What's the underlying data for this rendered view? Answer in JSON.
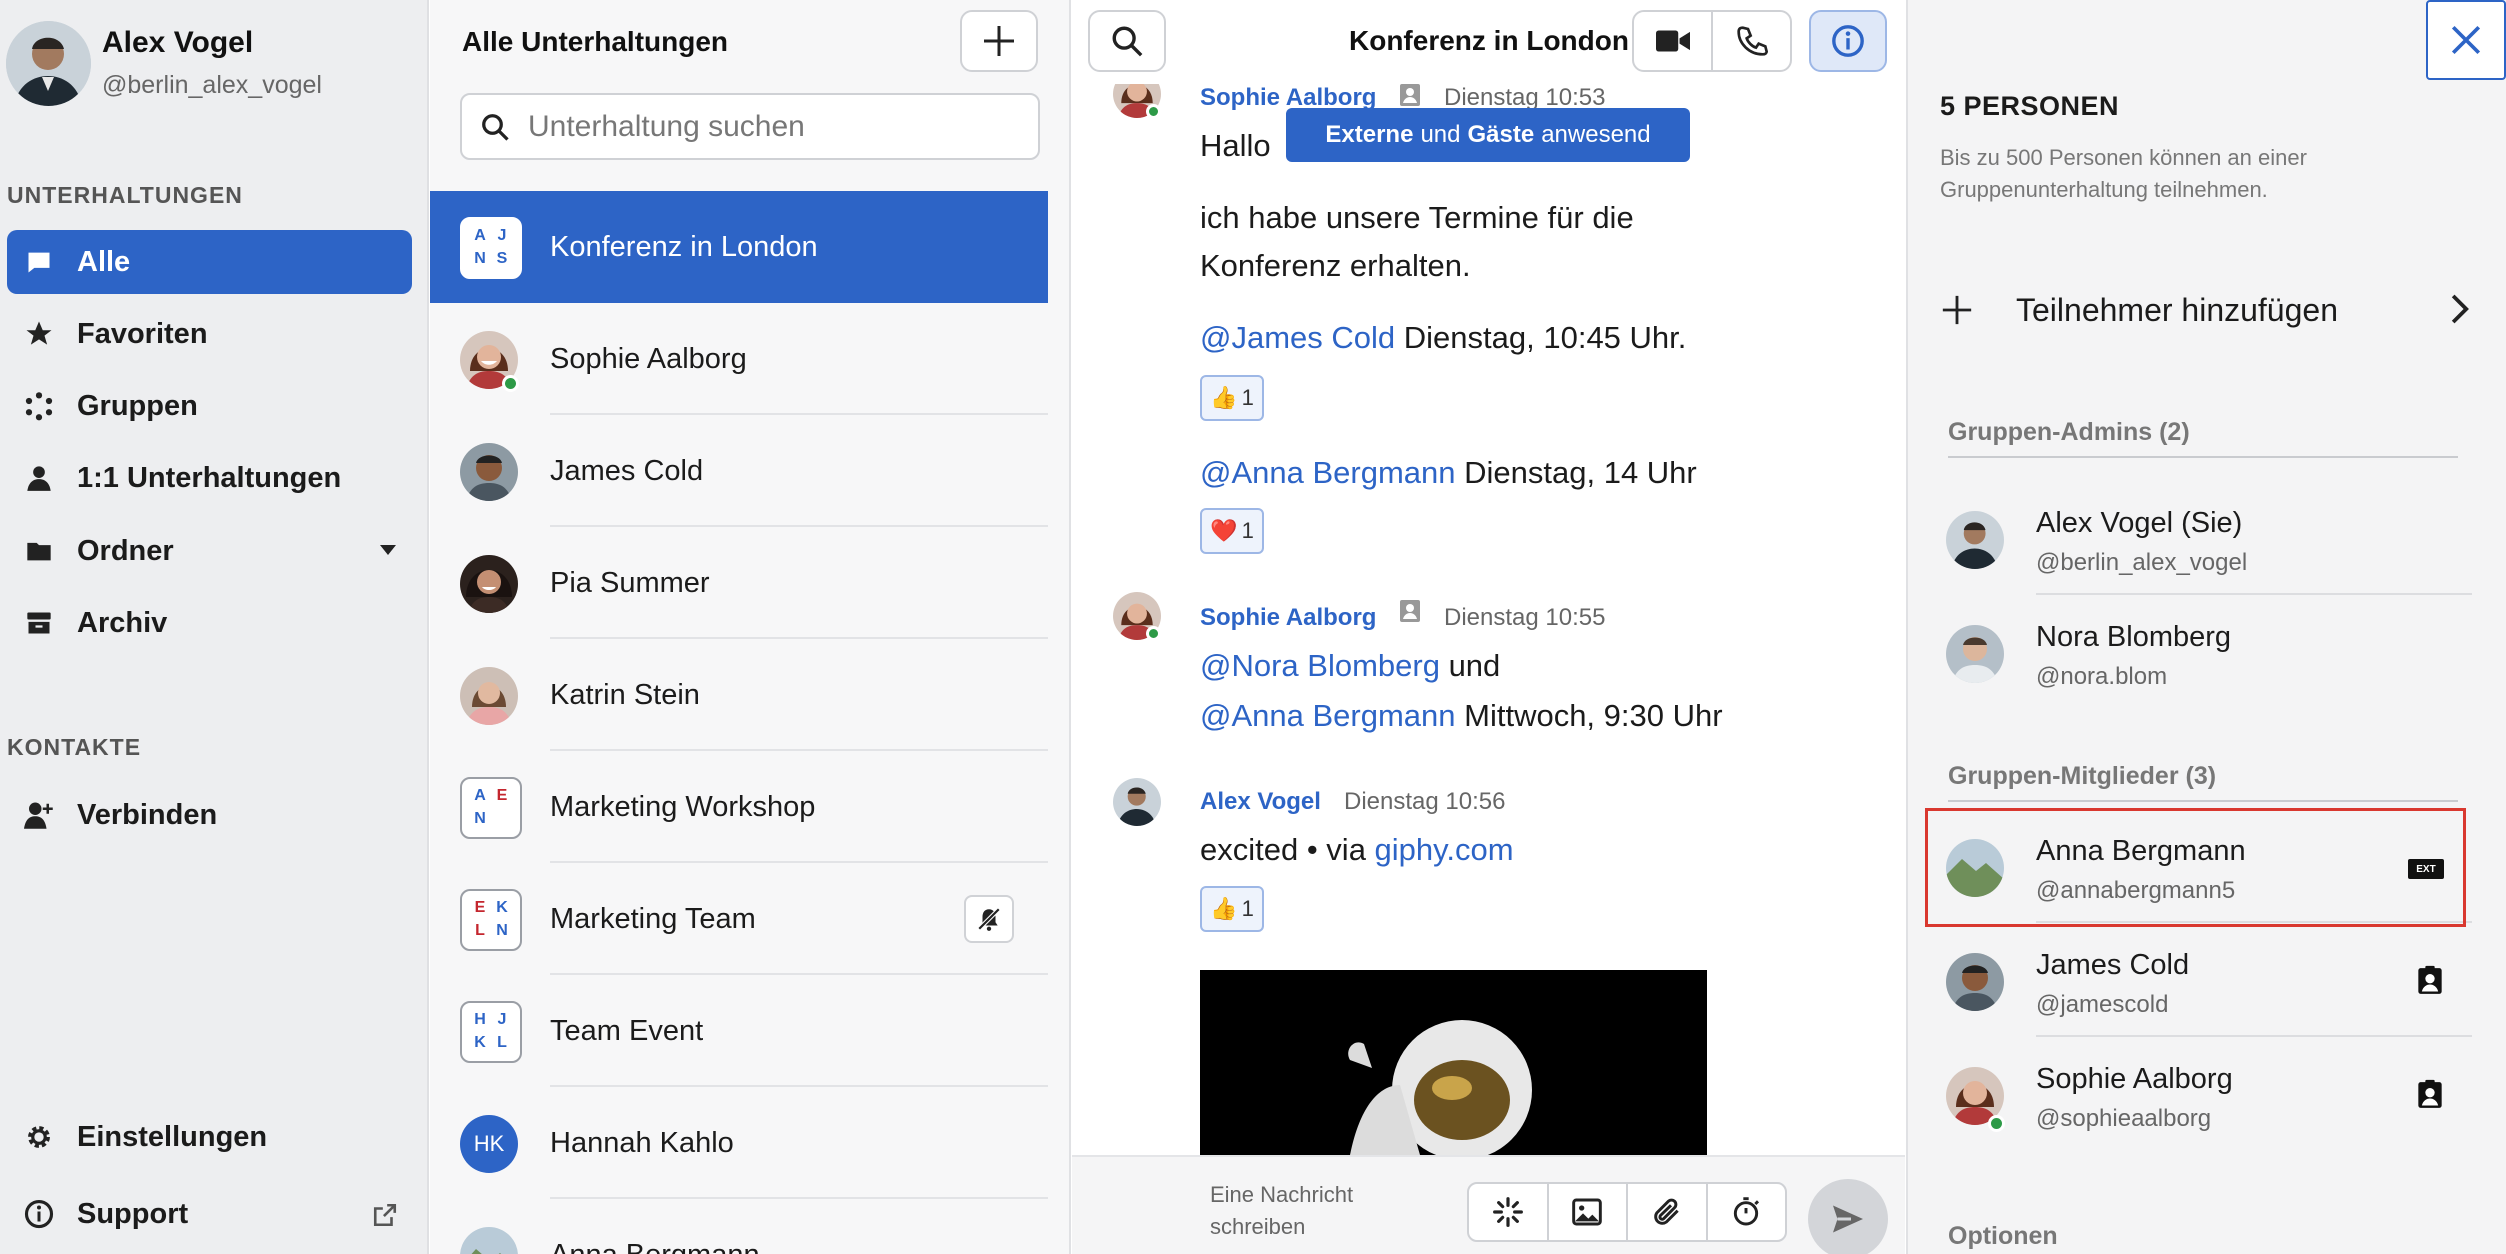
{
  "profile": {
    "name": "Alex Vogel",
    "handle": "@berlin_alex_vogel"
  },
  "sidebar": {
    "section_conversations": "UNTERHALTUNGEN",
    "items": [
      {
        "label": "Alle",
        "icon": "chat-bubble-icon",
        "active": true
      },
      {
        "label": "Favoriten",
        "icon": "star-icon"
      },
      {
        "label": "Gruppen",
        "icon": "group-dots-icon"
      },
      {
        "label": "1:1 Unterhaltungen",
        "icon": "person-icon"
      },
      {
        "label": "Ordner",
        "icon": "folder-icon"
      },
      {
        "label": "Archiv",
        "icon": "archive-icon"
      }
    ],
    "section_contacts": "KONTAKTE",
    "connect_label": "Verbinden",
    "settings_label": "Einstellungen",
    "support_label": "Support"
  },
  "conversations": {
    "title": "Alle Unterhaltungen",
    "search_placeholder": "Unterhaltung suchen",
    "items": [
      {
        "name": "Konferenz in London",
        "group": [
          [
            "A",
            "b"
          ],
          [
            "J",
            "b"
          ],
          [
            "N",
            "b"
          ],
          [
            "S",
            "b"
          ]
        ],
        "active": true
      },
      {
        "name": "Sophie Aalborg",
        "online": true
      },
      {
        "name": "James Cold"
      },
      {
        "name": "Pia Summer"
      },
      {
        "name": "Katrin Stein"
      },
      {
        "name": "Marketing Workshop",
        "group": [
          [
            "A",
            "b"
          ],
          [
            "E",
            "r"
          ],
          [
            "N",
            "b"
          ],
          [
            "",
            ""
          ]
        ]
      },
      {
        "name": "Marketing Team",
        "group": [
          [
            "E",
            "r"
          ],
          [
            "K",
            "b"
          ],
          [
            "L",
            "r"
          ],
          [
            "N",
            "b"
          ]
        ],
        "muted": true
      },
      {
        "name": "Team Event",
        "group": [
          [
            "H",
            "b"
          ],
          [
            "J",
            "b"
          ],
          [
            "K",
            "b"
          ],
          [
            "L",
            "b"
          ]
        ]
      },
      {
        "name": "Hannah Kahlo",
        "initials": "HK"
      },
      {
        "name": "Anna Bergmann"
      }
    ]
  },
  "chat": {
    "title": "Konferenz in London",
    "banner_strong1": "Externe",
    "banner_mid": "und",
    "banner_strong2": "Gäste",
    "banner_end": "anwesend",
    "msg1": {
      "sender": "Sophie Aalborg",
      "time": "Dienstag 10:53",
      "line0": "Hallo zusammen,",
      "line1": "ich habe unsere Termine für die",
      "line2": "Konferenz erhalten."
    },
    "mention1": {
      "name": "@James Cold",
      "text": " Dienstag, 10:45 Uhr.",
      "reaction_count": "1"
    },
    "mention2": {
      "name": "@Anna Bergmann",
      "text": " Dienstag, 14 Uhr",
      "reaction_count": "1"
    },
    "msg2": {
      "sender": "Sophie Aalborg",
      "time": "Dienstag 10:55",
      "m1": "@Nora Blomberg",
      "t1": " und",
      "m2": "@Anna Bergmann",
      "t2": " Mittwoch, 9:30 Uhr"
    },
    "msg3": {
      "sender": "Alex Vogel",
      "time": "Dienstag 10:56",
      "text": "excited • via ",
      "link": "giphy.com",
      "reaction_count": "1"
    },
    "composer_placeholder": "Eine Nachricht schreiben"
  },
  "panel": {
    "count": "5 PERSONEN",
    "note": "Bis zu 500 Personen können an einer Gruppenunterhaltung teilnehmen.",
    "add_label": "Teilnehmer hinzufügen",
    "admins_head": "Gruppen-Admins (2)",
    "admins": [
      {
        "name": "Alex Vogel  (Sie)",
        "handle": "@berlin_alex_vogel"
      },
      {
        "name": "Nora Blomberg",
        "handle": "@nora.blom"
      }
    ],
    "members_head": "Gruppen-Mitglieder (3)",
    "members": [
      {
        "name": "Anna Bergmann",
        "handle": "@annabergmann5",
        "tag": "EXT"
      },
      {
        "name": "James Cold",
        "handle": "@jamescold"
      },
      {
        "name": "Sophie Aalborg",
        "handle": "@sophieaalborg"
      }
    ],
    "options_head": "Optionen"
  },
  "colors": {
    "accent": "#2d64c6",
    "online": "#2d9a47",
    "highlight": "#d9382f"
  }
}
